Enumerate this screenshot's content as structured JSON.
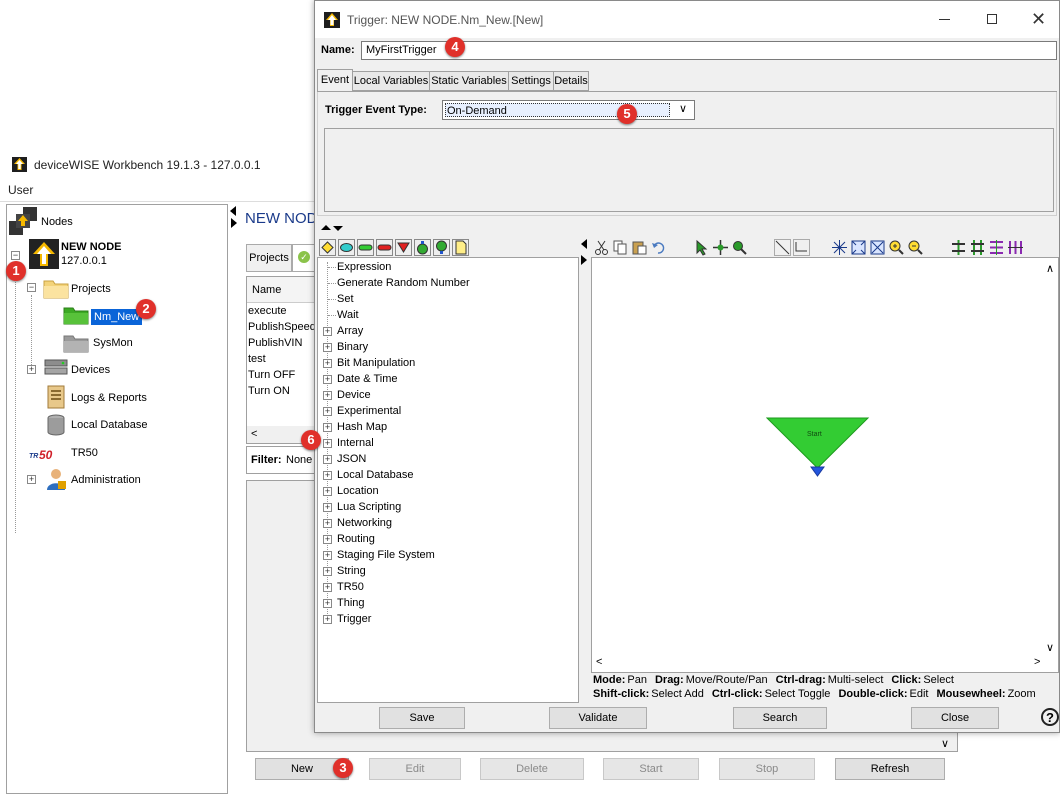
{
  "workbench": {
    "title": "deviceWISE Workbench 19.1.3  -  127.0.0.1",
    "menu_user": "User",
    "tree": {
      "root": "Nodes",
      "node_name": "NEW NODE",
      "node_ip": "127.0.0.1",
      "projects": "Projects",
      "project_selected": "Nm_New",
      "project_other": "SysMon",
      "devices": "Devices",
      "logs": "Logs & Reports",
      "local_db": "Local Database",
      "tr50": "TR50",
      "administration": "Administration"
    },
    "node_header": "NEW NODE",
    "tabs": {
      "projects": "Projects"
    },
    "list_header": "Name",
    "list_items": [
      "execute",
      "PublishSpeed",
      "PublishVIN",
      "test",
      "Turn OFF",
      "Turn ON"
    ],
    "filter_label": "Filter:",
    "filter_value": "None",
    "buttons": {
      "new": "New",
      "edit": "Edit",
      "delete": "Delete",
      "start": "Start",
      "stop": "Stop",
      "refresh": "Refresh"
    }
  },
  "trigger": {
    "title": "Trigger:  NEW NODE.Nm_New.[New]",
    "name_label": "Name:",
    "name_value": "MyFirstTrigger",
    "tabs": [
      "Event",
      "Local Variables",
      "Static Variables",
      "Settings",
      "Details"
    ],
    "event_type_label": "Trigger Event Type:",
    "event_type_value": "On-Demand",
    "palette": [
      {
        "label": "Expression",
        "expandable": false
      },
      {
        "label": "Generate Random Number",
        "expandable": false
      },
      {
        "label": "Set",
        "expandable": false
      },
      {
        "label": "Wait",
        "expandable": false
      },
      {
        "label": "Array",
        "expandable": true
      },
      {
        "label": "Binary",
        "expandable": true
      },
      {
        "label": "Bit Manipulation",
        "expandable": true
      },
      {
        "label": "Date & Time",
        "expandable": true
      },
      {
        "label": "Device",
        "expandable": true
      },
      {
        "label": "Experimental",
        "expandable": true
      },
      {
        "label": "Hash Map",
        "expandable": true
      },
      {
        "label": "Internal",
        "expandable": true
      },
      {
        "label": "JSON",
        "expandable": true
      },
      {
        "label": "Local Database",
        "expandable": true
      },
      {
        "label": "Location",
        "expandable": true
      },
      {
        "label": "Lua Scripting",
        "expandable": true
      },
      {
        "label": "Networking",
        "expandable": true
      },
      {
        "label": "Routing",
        "expandable": true
      },
      {
        "label": "Staging File System",
        "expandable": true
      },
      {
        "label": "String",
        "expandable": true
      },
      {
        "label": "TR50",
        "expandable": true
      },
      {
        "label": "Thing",
        "expandable": true
      },
      {
        "label": "Trigger",
        "expandable": true
      }
    ],
    "canvas_start_label": "Start",
    "status": {
      "l1": [
        [
          "Mode:",
          "Pan"
        ],
        [
          "Drag:",
          "Move/Route/Pan"
        ],
        [
          "Ctrl-drag:",
          "Multi-select"
        ],
        [
          "Click:",
          "Select"
        ]
      ],
      "l2": [
        [
          "Shift-click:",
          "Select Add"
        ],
        [
          "Ctrl-click:",
          "Select Toggle"
        ],
        [
          "Double-click:",
          "Edit"
        ],
        [
          "Mousewheel:",
          "Zoom"
        ]
      ]
    },
    "buttons": {
      "save": "Save",
      "validate": "Validate",
      "search": "Search",
      "close": "Close"
    },
    "help_glyph": "?"
  },
  "callouts": [
    "1",
    "2",
    "3",
    "4",
    "5",
    "6"
  ],
  "colors": {
    "selection": "#0a64d8",
    "start_node": "#33cc33",
    "callout": "#e0302a"
  }
}
